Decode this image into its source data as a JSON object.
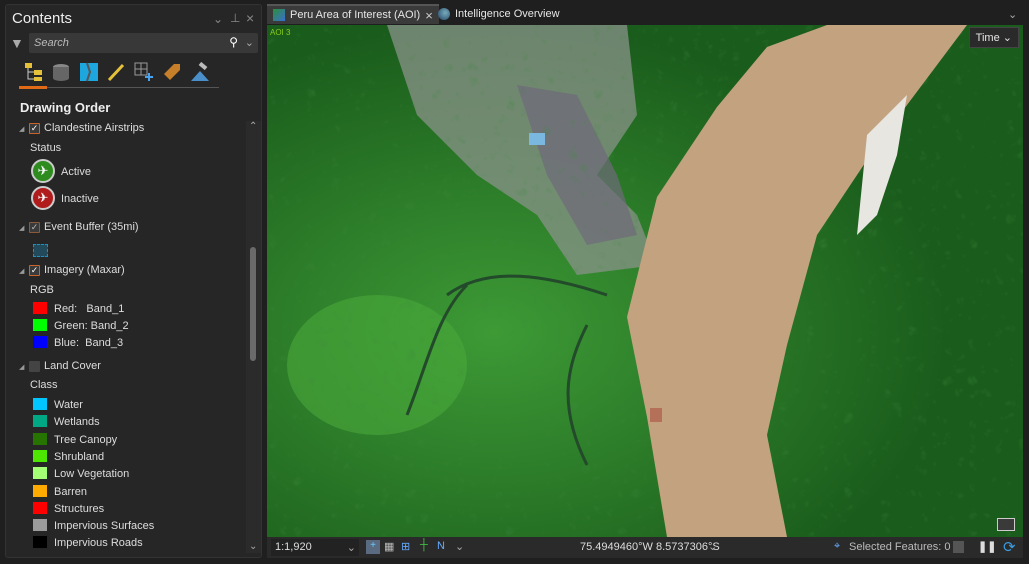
{
  "contents": {
    "title": "Contents",
    "search_placeholder": "Search",
    "section": "Drawing Order",
    "layers": {
      "airstrips": {
        "name": "Clandestine Airstrips",
        "checked": true,
        "field": "Status",
        "classes": [
          {
            "label": "Active",
            "color": "#2e8b1e"
          },
          {
            "label": "Inactive",
            "color": "#b01c1c"
          }
        ]
      },
      "buffer": {
        "name": "Event Buffer (35mi)",
        "checked": true
      },
      "imagery": {
        "name": "Imagery (Maxar)",
        "checked": true,
        "field": "RGB",
        "bands": [
          {
            "label": "Red:   Band_1",
            "color": "#ff0000"
          },
          {
            "label": "Green: Band_2",
            "color": "#00ff00"
          },
          {
            "label": "Blue:  Band_3",
            "color": "#0000ff"
          }
        ]
      },
      "landcover": {
        "name": "Land Cover",
        "checked": false,
        "field": "Class",
        "classes": [
          {
            "label": "Water",
            "color": "#00c5ff"
          },
          {
            "label": "Wetlands",
            "color": "#00a884"
          },
          {
            "label": "Tree Canopy",
            "color": "#267300"
          },
          {
            "label": "Shrubland",
            "color": "#4ce600"
          },
          {
            "label": "Low Vegetation",
            "color": "#a3ff73"
          },
          {
            "label": "Barren",
            "color": "#ffaa00"
          },
          {
            "label": "Structures",
            "color": "#ff0000"
          },
          {
            "label": "Impervious Surfaces",
            "color": "#9c9c9c"
          },
          {
            "label": "Impervious Roads",
            "color": "#000000"
          }
        ]
      }
    }
  },
  "tabs": [
    {
      "label": "Peru Area of Interest (AOI)",
      "active": true
    },
    {
      "label": "Intelligence Overview",
      "active": false
    }
  ],
  "map": {
    "label": "AOI 3",
    "time_button": "Time"
  },
  "status": {
    "scale": "1:1,920",
    "coordinates": "75.4949460°W 8.5737306°S",
    "selected_features": "Selected Features: 0"
  }
}
